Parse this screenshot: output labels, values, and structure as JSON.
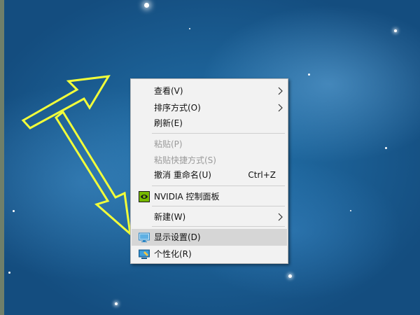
{
  "desktop": {
    "background_color": "#1d5c92",
    "annotation_color": "#f2ff3a"
  },
  "context_menu": {
    "items": [
      {
        "label": "查看(V)",
        "has_submenu": true,
        "enabled": true
      },
      {
        "label": "排序方式(O)",
        "has_submenu": true,
        "enabled": true
      },
      {
        "label": "刷新(E)",
        "enabled": true
      },
      {
        "label": "粘贴(P)",
        "enabled": false
      },
      {
        "label": "粘贴快捷方式(S)",
        "enabled": false
      },
      {
        "label": "撤消 重命名(U)",
        "shortcut": "Ctrl+Z",
        "enabled": true
      },
      {
        "label": "NVIDIA 控制面板",
        "icon": "nvidia-icon",
        "enabled": true
      },
      {
        "label": "新建(W)",
        "has_submenu": true,
        "enabled": true
      },
      {
        "label": "显示设置(D)",
        "icon": "display-icon",
        "enabled": true,
        "highlighted": true
      },
      {
        "label": "个性化(R)",
        "icon": "personalize-icon",
        "enabled": true
      }
    ]
  }
}
